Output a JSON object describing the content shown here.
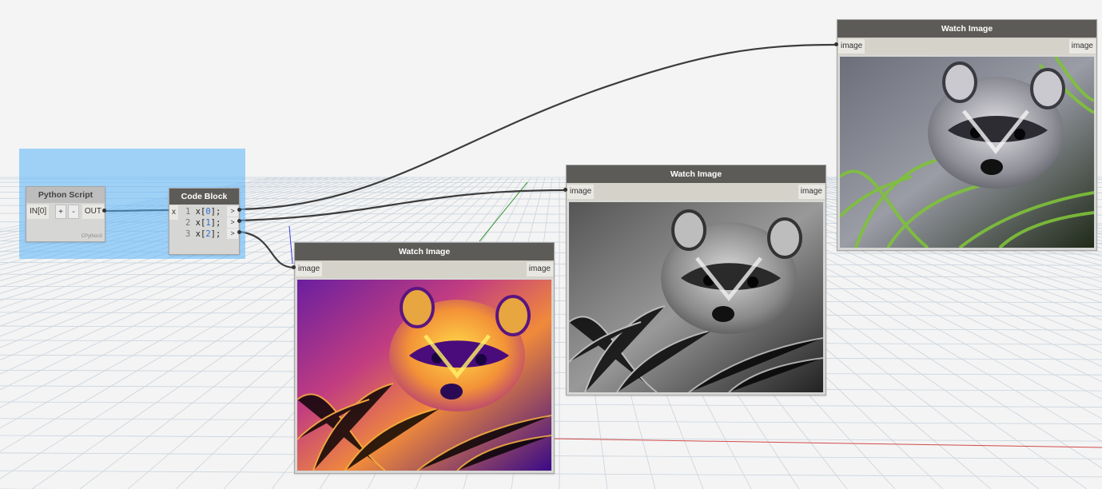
{
  "python_node": {
    "title": "Python Script",
    "input_port": "IN[0]",
    "add_button": "+",
    "remove_button": "-",
    "output_port": "OUT",
    "engine": "CPython3"
  },
  "code_block": {
    "title": "Code Block",
    "input_port": "x",
    "lines": [
      {
        "number": "1",
        "pre": "x[",
        "index": "0",
        "post": "];"
      },
      {
        "number": "2",
        "pre": "x[",
        "index": "1",
        "post": "];"
      },
      {
        "number": "3",
        "pre": "x[",
        "index": "2",
        "post": "];"
      }
    ],
    "output_arrow": ">"
  },
  "watch_nodes": [
    {
      "title": "Watch Image",
      "input_port": "image",
      "output_port": "image",
      "colormap": "plasma"
    },
    {
      "title": "Watch Image",
      "input_port": "image",
      "output_port": "image",
      "colormap": "grayscale"
    },
    {
      "title": "Watch Image",
      "input_port": "image",
      "output_port": "image",
      "colormap": "color"
    }
  ],
  "colors": {
    "selection": "#5ab4fa",
    "wire": "#3c3c3c",
    "node_header_dark": "#5d5b58",
    "axis_red": "#d24a4a",
    "axis_green": "#3a9a3a",
    "axis_blue": "#3a3ad8"
  }
}
